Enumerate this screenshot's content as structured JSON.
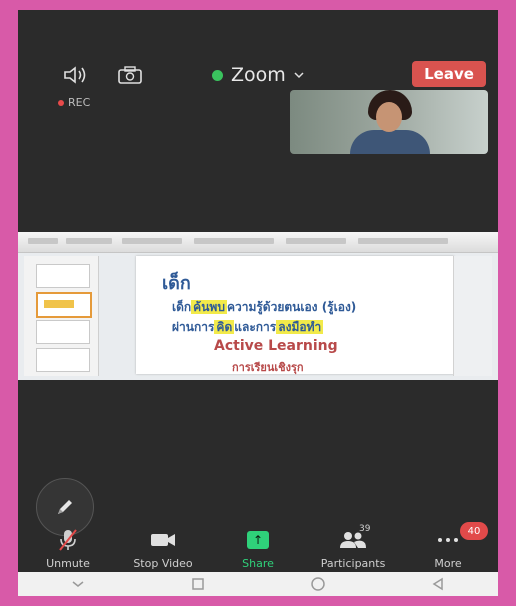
{
  "status_bar": {
    "left": "",
    "right": ""
  },
  "header": {
    "meeting_name": "Zoom",
    "leave_label": "Leave",
    "rec_label": "REC"
  },
  "shared_slide": {
    "title": "เด็ก",
    "logo_text": "",
    "line1_parts": [
      "เด็ก",
      "ค้นพบ",
      "ความรู้ด้วยตนเอง (รู้เอง)"
    ],
    "line2_parts": [
      "ผ่านการ",
      "คิด",
      "และการ",
      "ลงมือทำ"
    ],
    "line3": "Active Learning",
    "line4": "การเรียนเชิงรุก"
  },
  "toolbar": {
    "unmute_label": "Unmute",
    "stop_video_label": "Stop Video",
    "share_label": "Share",
    "participants_label": "Participants",
    "participants_count": "39",
    "more_label": "More",
    "more_badge": "40"
  },
  "icons": {
    "audio": "speaker-icon",
    "camera_flip": "camera-flip-icon",
    "annotate": "pencil-icon",
    "unmute": "mic-muted-icon",
    "video": "video-camera-icon",
    "share": "share-arrow-icon",
    "participants": "people-icon",
    "more": "more-dots-icon",
    "nav_back": "chevron-down-icon",
    "nav_home": "circle-icon",
    "nav_recent": "square-icon",
    "nav_back_triangle": "triangle-left-icon"
  },
  "colors": {
    "frame": "#d85aa8",
    "background": "#2b2b2b",
    "leave": "#d9534f",
    "share_active": "#2fd17a",
    "badge": "#e24a4a",
    "slide_text": "#2f5a97",
    "highlight": "#f2ea4a"
  }
}
